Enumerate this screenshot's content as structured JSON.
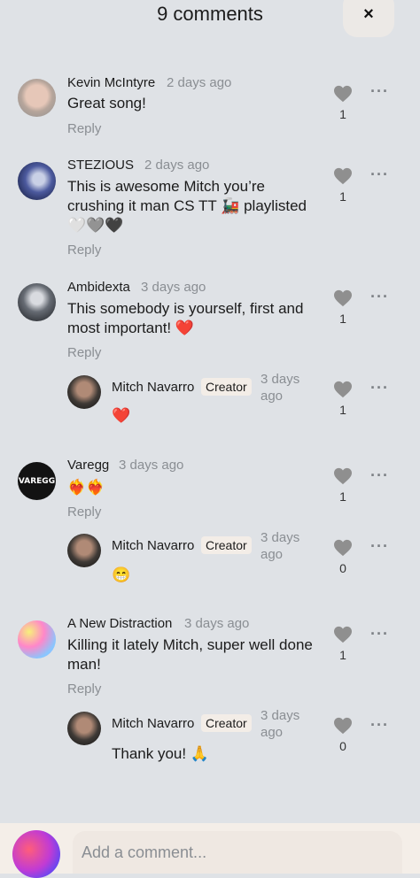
{
  "header": {
    "title": "9 comments",
    "close_label": "×"
  },
  "comments": [
    {
      "name": "Kevin McIntyre",
      "time": "2 days ago",
      "text": "Great song!",
      "likes": "1",
      "reply": "Reply"
    },
    {
      "name": "STEZIOUS",
      "time": "2 days ago",
      "text_line1": "This is awesome Mitch you’re",
      "text_line2": "crushing it man CS TT 🚂 playlisted",
      "text_line3": "🤍🩶🖤",
      "likes": "1",
      "reply": "Reply"
    },
    {
      "name": "Ambidexta",
      "time": "3 days ago",
      "text_line1": "This somebody is yourself, first and",
      "text_line2": "most important! ❤️",
      "likes": "1",
      "reply": "Reply",
      "reply_item": {
        "name": "Mitch Navarro",
        "badge": "Creator",
        "time_line1": "3 days",
        "time_line2": "ago",
        "text": "❤️",
        "likes": "1"
      }
    },
    {
      "name": "Varegg",
      "time": "3 days ago",
      "text": "❤️‍🔥❤️‍🔥",
      "likes": "1",
      "reply": "Reply",
      "reply_item": {
        "name": "Mitch Navarro",
        "badge": "Creator",
        "time_line1": "3 days",
        "time_line2": "ago",
        "text": "😁",
        "likes": "0"
      }
    },
    {
      "name": "A New Distraction",
      "time": "3 days ago",
      "text_line1": "Killing it lately Mitch, super well done",
      "text_line2": "man!",
      "likes": "1",
      "reply": "Reply",
      "reply_item": {
        "name": "Mitch Navarro",
        "badge": "Creator",
        "time_line1": "3 days",
        "time_line2": "ago",
        "text": "Thank you! 🙏",
        "likes": "0"
      }
    }
  ],
  "avatar_texts": {
    "varegg": "VAREGG"
  },
  "footer": {
    "placeholder": "Add a comment..."
  }
}
